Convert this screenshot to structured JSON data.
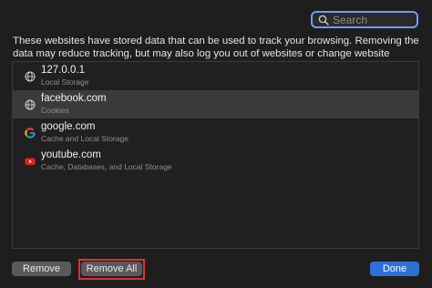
{
  "search": {
    "placeholder": "Search",
    "icon": "magnifier"
  },
  "description": "These websites have stored data that can be used to track your browsing. Removing the data may reduce tracking, but may also log you out of websites or change website behaviour.",
  "sites": [
    {
      "name": "127.0.0.1",
      "detail": "Local Storage",
      "icon": "globe",
      "selected": false
    },
    {
      "name": "facebook.com",
      "detail": "Cookies",
      "icon": "globe",
      "selected": true
    },
    {
      "name": "google.com",
      "detail": "Cache and Local Storage",
      "icon": "google-logo",
      "selected": false
    },
    {
      "name": "youtube.com",
      "detail": "Cache, Databases, and Local Storage",
      "icon": "youtube-logo",
      "selected": false
    }
  ],
  "buttons": {
    "remove": "Remove",
    "remove_all": "Remove All",
    "done": "Done"
  },
  "colors": {
    "accent": "#2e6fd8",
    "highlight": "#e0302c",
    "search_focus": "#6f9ef6"
  }
}
